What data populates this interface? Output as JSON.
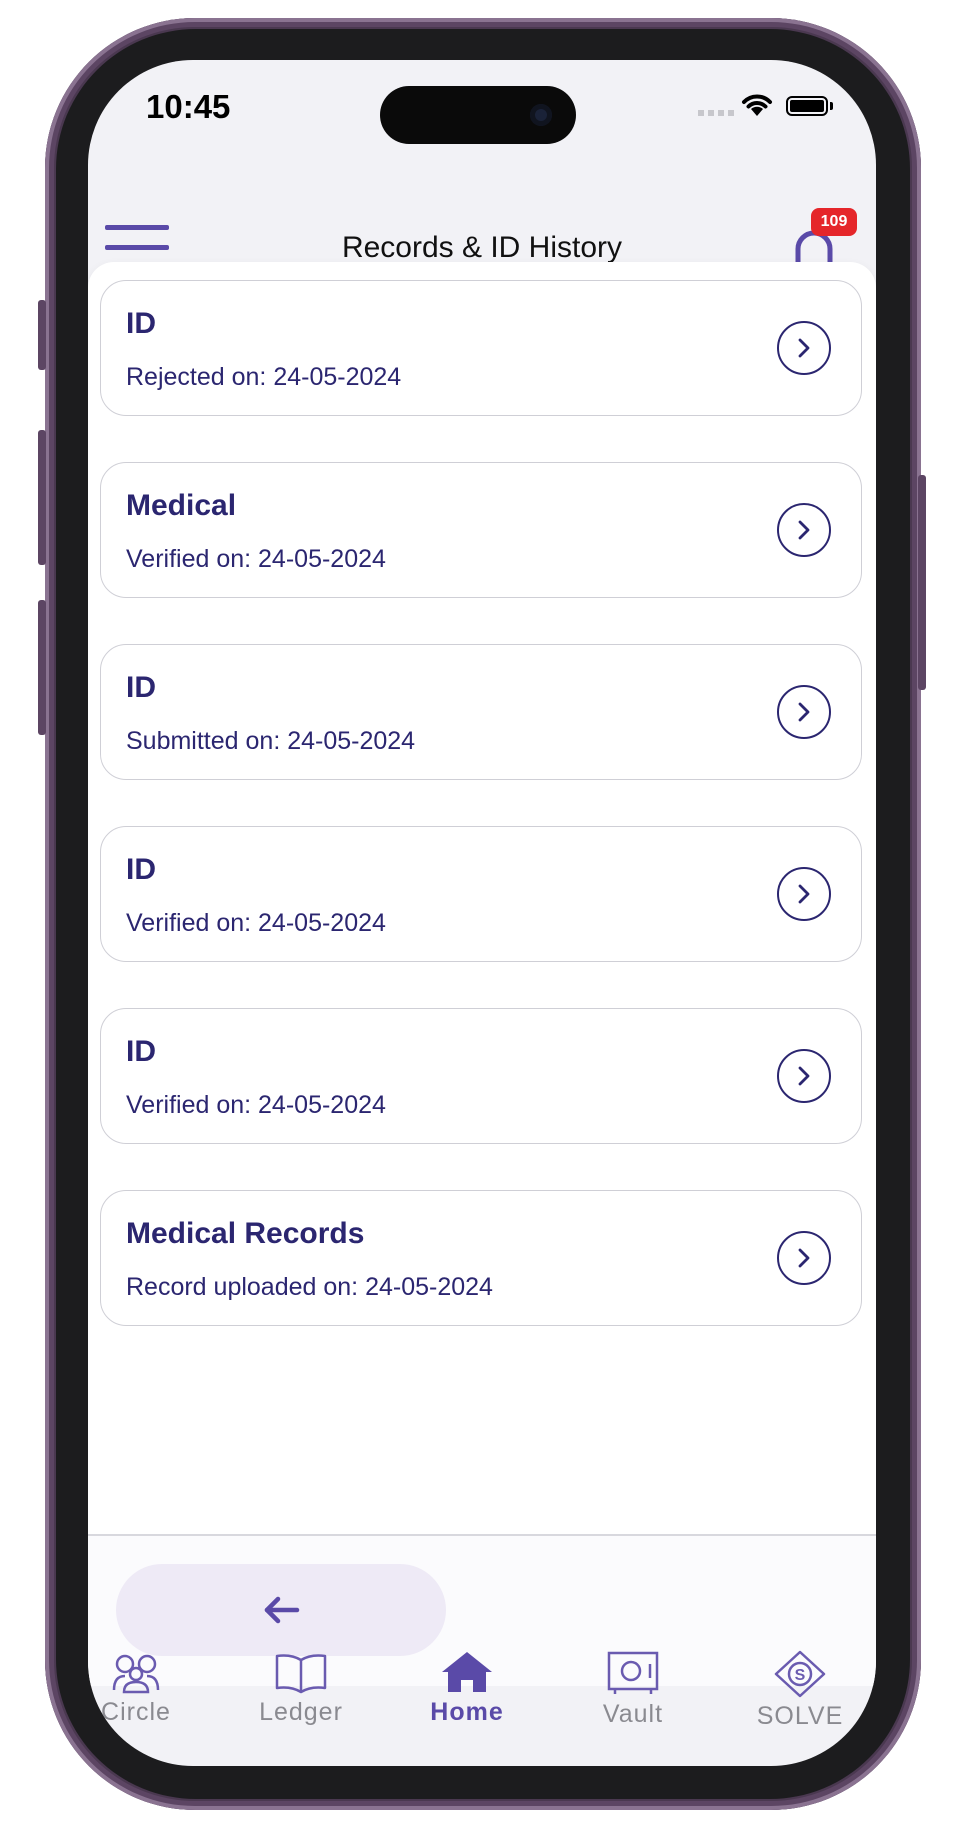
{
  "status_bar": {
    "time": "10:45"
  },
  "header": {
    "title": "Records & ID History",
    "notification_count": "109"
  },
  "records": [
    {
      "title": "ID",
      "subtitle": "Rejected on: 24-05-2024"
    },
    {
      "title": "Medical",
      "subtitle": "Verified on: 24-05-2024"
    },
    {
      "title": "ID",
      "subtitle": "Submitted on: 24-05-2024"
    },
    {
      "title": "ID",
      "subtitle": "Verified on: 24-05-2024"
    },
    {
      "title": "ID",
      "subtitle": "Verified on: 24-05-2024"
    },
    {
      "title": "Medical Records",
      "subtitle": "Record uploaded on: 24-05-2024"
    }
  ],
  "footer": {
    "back_icon": "arrow-left-icon"
  },
  "tabbar": {
    "items": [
      {
        "label": "Circle",
        "icon": "people-icon"
      },
      {
        "label": "Ledger",
        "icon": "book-icon"
      },
      {
        "label": "Home",
        "icon": "home-icon",
        "active": true
      },
      {
        "label": "Vault",
        "icon": "safe-icon"
      },
      {
        "label": "SOLVE",
        "icon": "solve-diamond-icon"
      }
    ]
  },
  "colors": {
    "primary": "#5a4aa8",
    "text_dark": "#2b2670",
    "badge": "#e5262a",
    "inactive": "#8a8a90"
  }
}
